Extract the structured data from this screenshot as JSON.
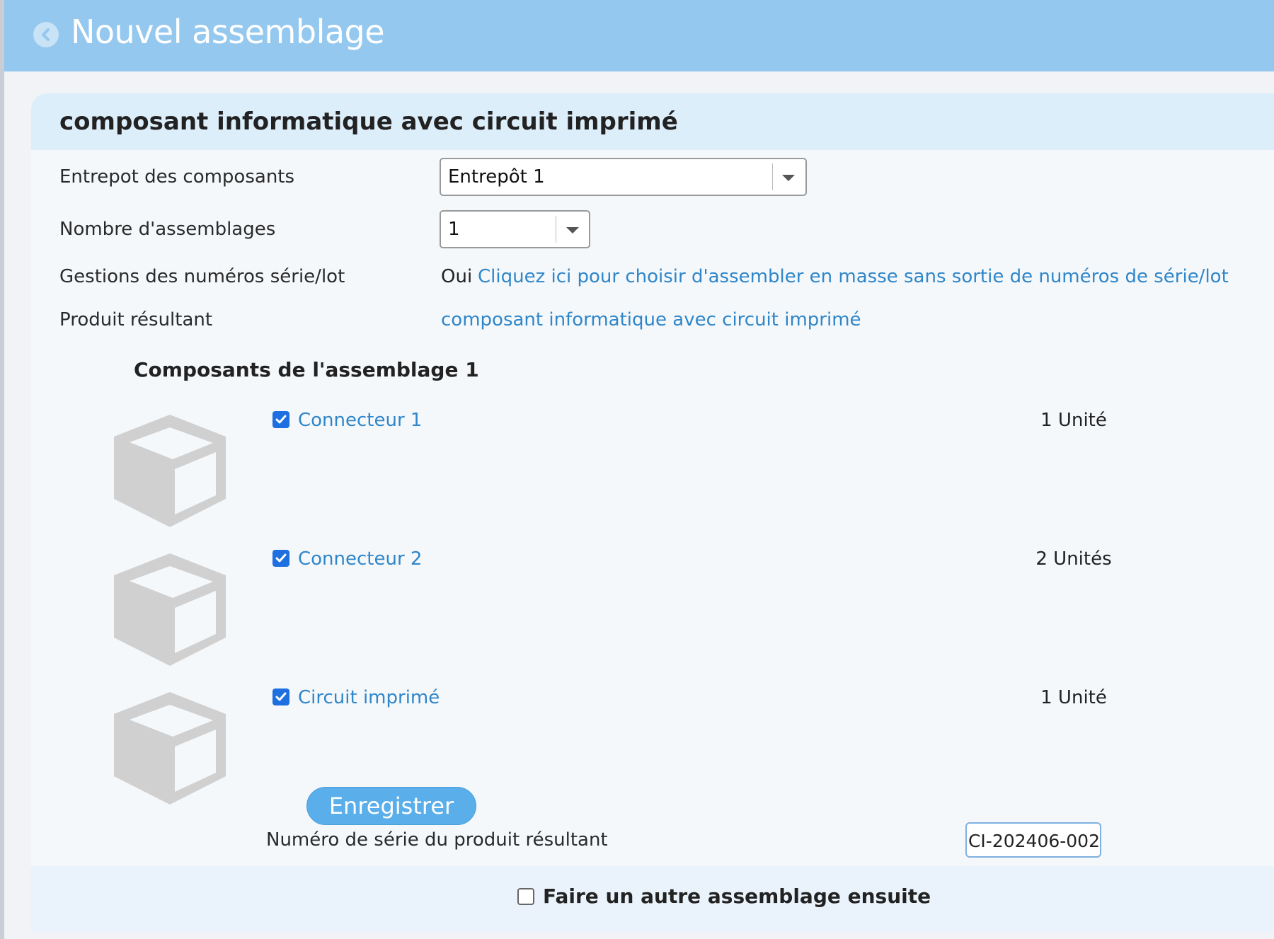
{
  "header": {
    "title": "Nouvel assemblage"
  },
  "card": {
    "title": "composant informatique avec circuit imprimé"
  },
  "form": {
    "warehouse_label": "Entrepot des composants",
    "warehouse_value": "Entrepôt 1",
    "count_label": "Nombre d'assemblages",
    "count_value": "1",
    "serial_mgmt_label": "Gestions des numéros série/lot",
    "serial_mgmt_value": "Oui",
    "serial_mgmt_link": "Cliquez ici pour choisir d'assembler en masse sans sortie de numéros de série/lot",
    "result_label": "Produit résultant",
    "result_link": "composant informatique avec circuit imprimé"
  },
  "components": {
    "title": "Composants de l'assemblage 1",
    "items": [
      {
        "name": "Connecteur 1",
        "qty": "1 Unité",
        "checked": true,
        "icon": "box-icon"
      },
      {
        "name": "Connecteur 2",
        "qty": "2 Unités",
        "checked": true,
        "icon": "box-icon"
      },
      {
        "name": "Circuit imprimé",
        "qty": "1 Unité",
        "checked": true,
        "icon": "box-icon"
      }
    ]
  },
  "serial": {
    "label": "Numéro de série du produit résultant",
    "value": "CI-202406-002"
  },
  "footer": {
    "save_label": "Enregistrer",
    "again_label": "Faire un autre assemblage ensuite",
    "again_checked": false
  },
  "colors": {
    "header": "#95c8ef",
    "link": "#2f86c9",
    "button": "#5aaeea",
    "checkbox": "#1e6fe0"
  }
}
